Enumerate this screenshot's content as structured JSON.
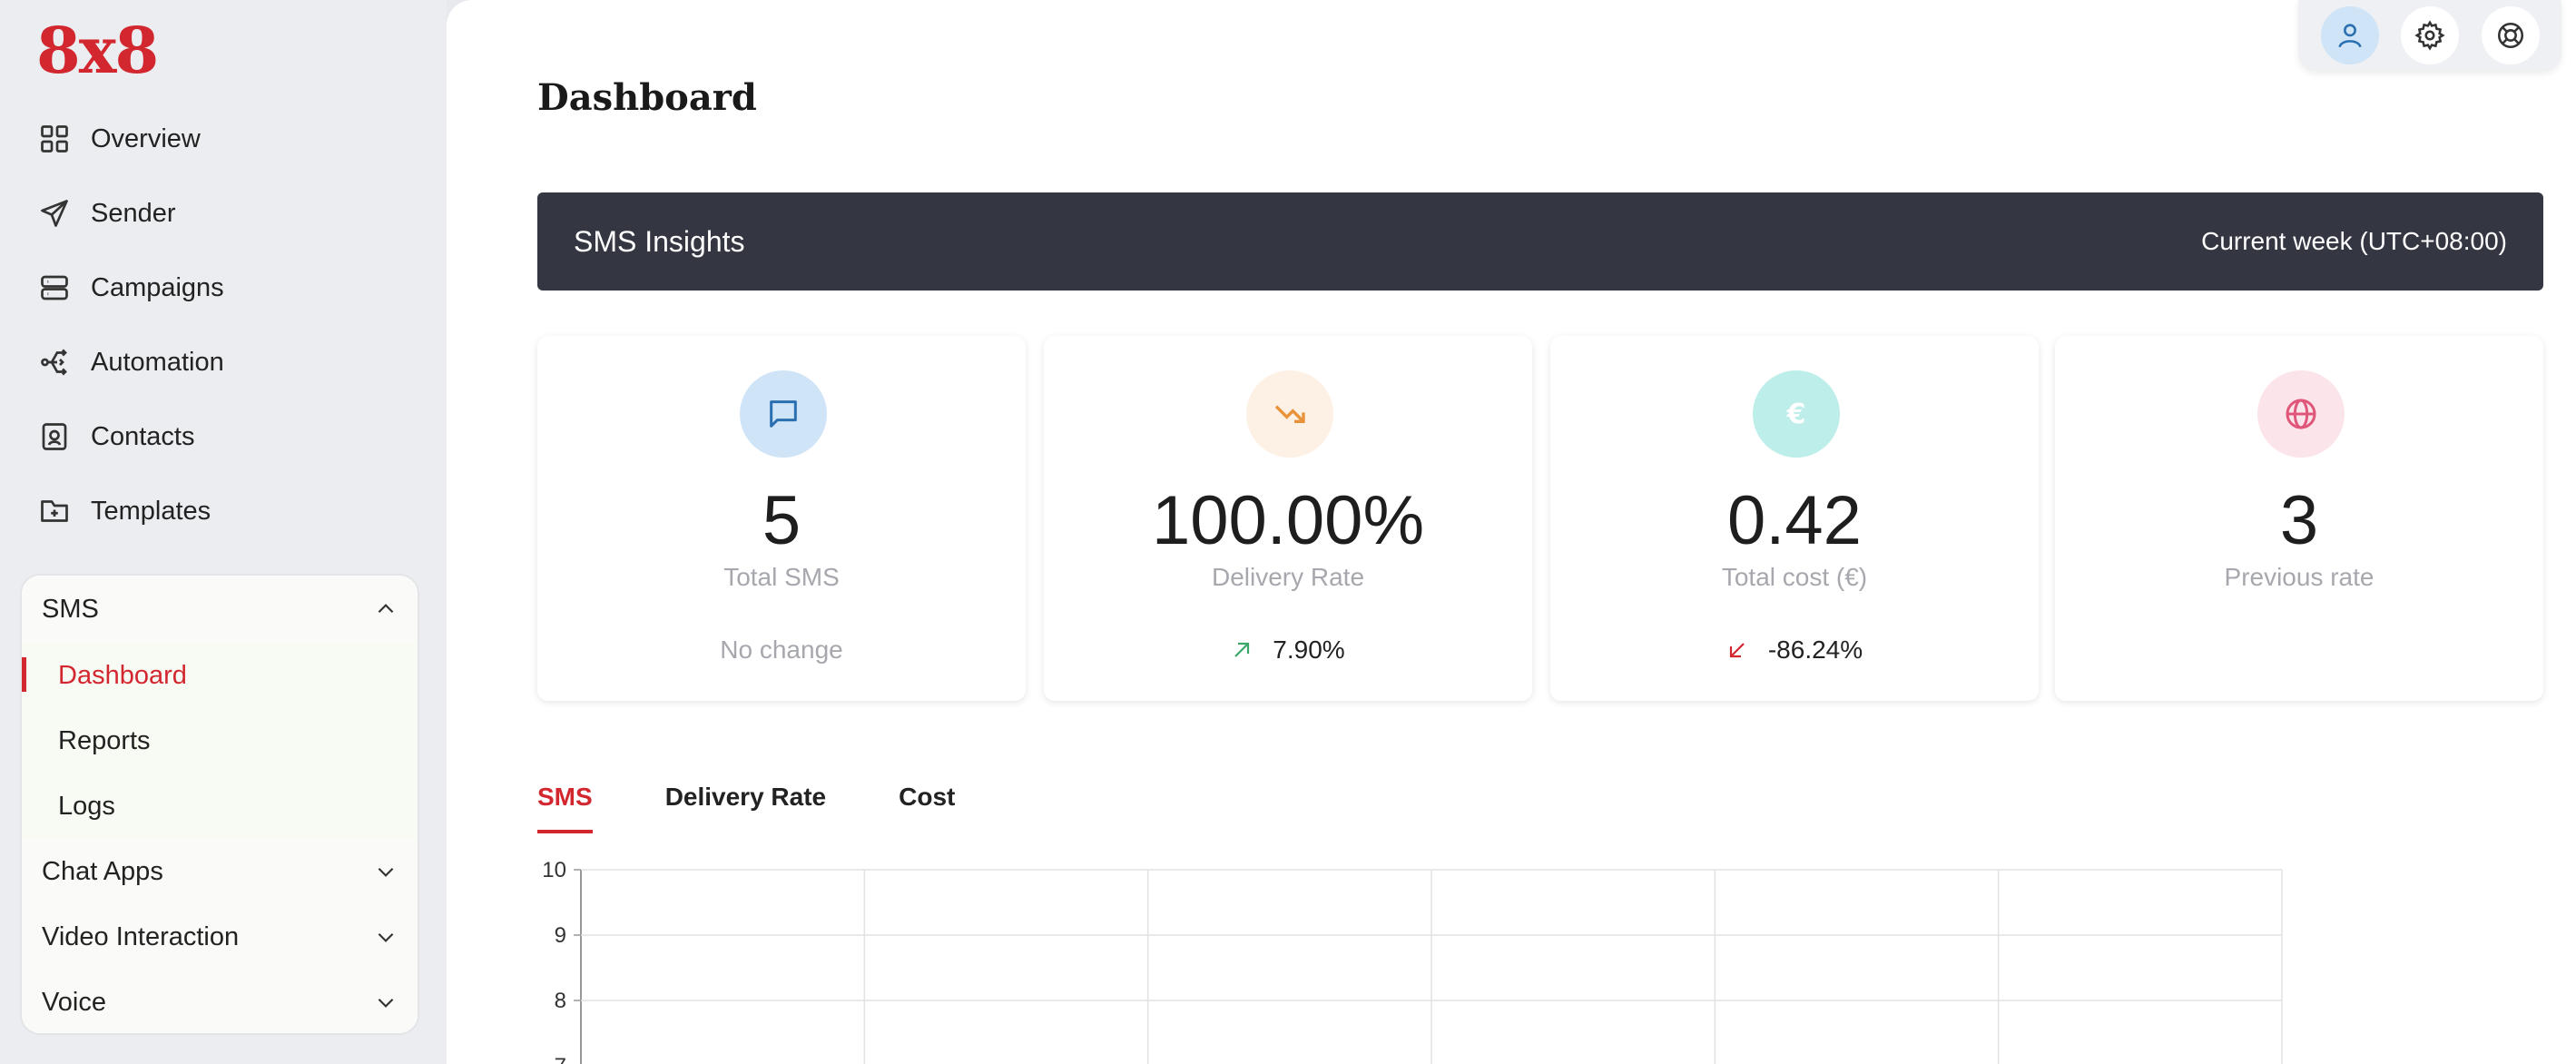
{
  "brand": {
    "logo": "8x8"
  },
  "sidebar": {
    "nav": [
      {
        "label": "Overview",
        "icon": "grid-icon"
      },
      {
        "label": "Sender",
        "icon": "send-icon"
      },
      {
        "label": "Campaigns",
        "icon": "server-icon"
      },
      {
        "label": "Automation",
        "icon": "branch-icon"
      },
      {
        "label": "Contacts",
        "icon": "contact-book-icon"
      },
      {
        "label": "Templates",
        "icon": "folder-plus-icon"
      }
    ],
    "sms_group": {
      "label": "SMS",
      "items": [
        {
          "label": "Dashboard",
          "active": true
        },
        {
          "label": "Reports"
        },
        {
          "label": "Logs"
        }
      ]
    },
    "collapsed_groups": [
      "Chat Apps",
      "Video Interaction",
      "Voice"
    ]
  },
  "topbar": {
    "icons": [
      "user-icon",
      "gear-icon",
      "lifebuoy-icon"
    ]
  },
  "page": {
    "title": "Dashboard"
  },
  "insights": {
    "title": "SMS Insights",
    "period": "Current week (UTC+08:00)"
  },
  "cards": [
    {
      "value": "5",
      "label": "Total SMS",
      "change": "No change",
      "icon": "message-icon",
      "color": "#cfe4f7"
    },
    {
      "value": "100.00%",
      "label": "Delivery Rate",
      "change": "7.90%",
      "trend": "up",
      "icon": "trending-down-icon",
      "color": "#fdf0e4"
    },
    {
      "value": "0.42",
      "label": "Total cost (€)",
      "change": "-86.24%",
      "trend": "down",
      "icon": "euro-icon",
      "color": "#bdeee9"
    },
    {
      "value": "3",
      "label": "Previous rate",
      "change": "",
      "icon": "globe-icon",
      "color": "#fbe4ea"
    }
  ],
  "tabs": [
    {
      "label": "SMS",
      "active": true
    },
    {
      "label": "Delivery Rate"
    },
    {
      "label": "Cost"
    }
  ],
  "chart_data": {
    "type": "line",
    "y_tick_labels": [
      "10",
      "9",
      "8",
      "7"
    ],
    "grid": true,
    "series": []
  }
}
